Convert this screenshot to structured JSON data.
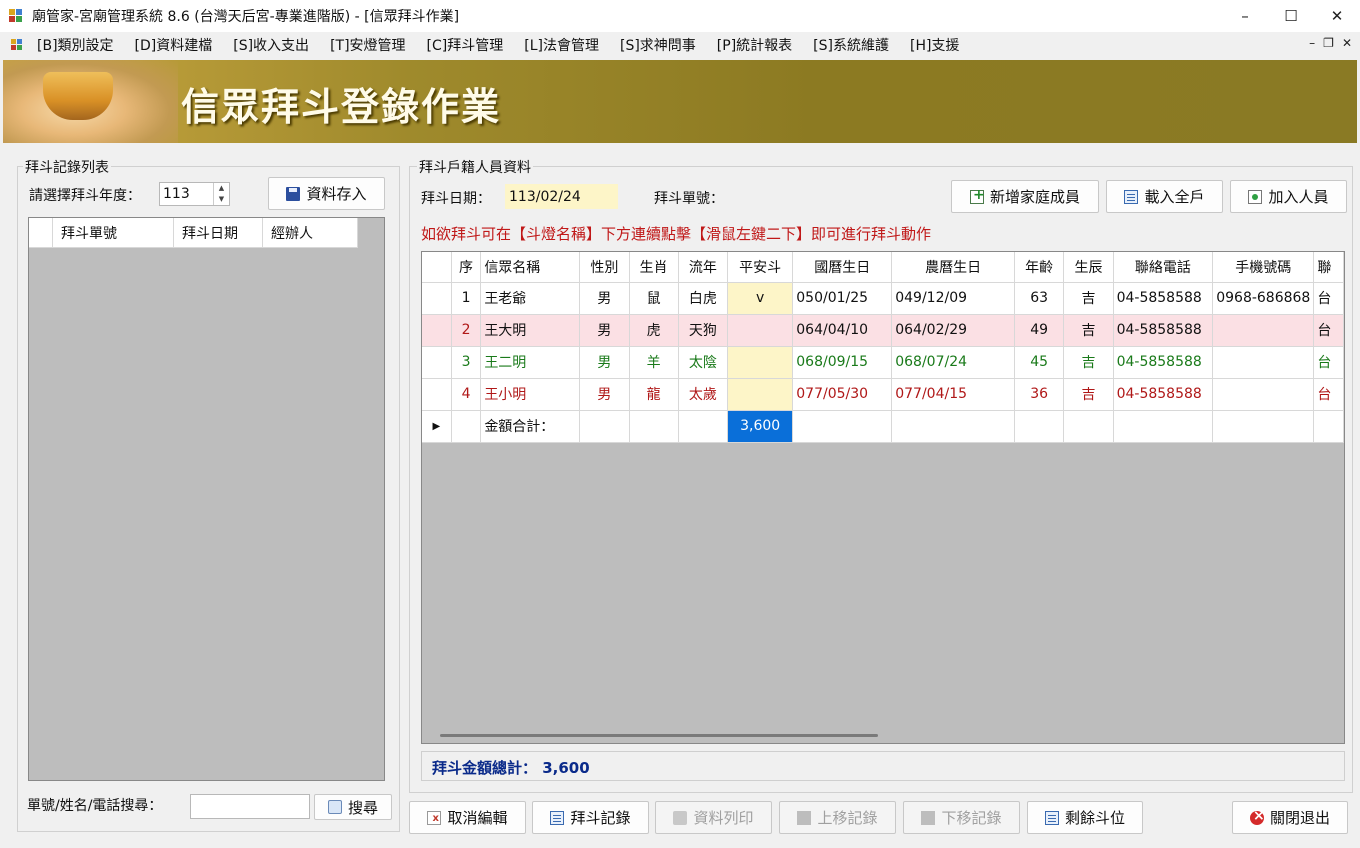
{
  "window": {
    "title": "廟管家-宮廟管理系統 8.6 (台灣天后宮-專業進階版) - [信眾拜斗作業]",
    "controls": [
      "–",
      "☐",
      "✕"
    ]
  },
  "menu": {
    "items": [
      "[B]類別設定",
      "[D]資料建檔",
      "[S]收入支出",
      "[T]安燈管理",
      "[C]拜斗管理",
      "[L]法會管理",
      "[S]求神問事",
      "[P]統計報表",
      "[S]系統維護",
      "[H]支援"
    ],
    "mdi_controls": [
      "–",
      "❐",
      "✕"
    ]
  },
  "banner": {
    "title": "信眾拜斗登錄作業"
  },
  "left_panel": {
    "group_label": "拜斗記錄列表",
    "year_label": "請選擇拜斗年度：",
    "year_value": "113",
    "save_button": "資料存入",
    "list_columns": [
      "拜斗單號",
      "拜斗日期",
      "經辦人"
    ],
    "search_label": "單號/姓名/電話搜尋：",
    "search_value": "",
    "search_button": "搜尋"
  },
  "right_panel": {
    "group_label": "拜斗戶籍人員資料",
    "date_label": "拜斗日期：",
    "date_value": "113/02/24",
    "order_label": "拜斗單號：",
    "buttons": {
      "add_family": "新增家庭成員",
      "load_household": "載入全戶",
      "add_person": "加入人員"
    },
    "notice": "如欲拜斗可在【斗燈名稱】下方連續點擊【滑鼠左鍵二下】即可進行拜斗動作",
    "columns": [
      "序",
      "信眾名稱",
      "性別",
      "生肖",
      "流年",
      "平安斗",
      "國曆生日",
      "農曆生日",
      "年齡",
      "生辰",
      "聯絡電話",
      "手機號碼",
      "聯"
    ],
    "rows": [
      {
        "seq": "1",
        "name": "王老爺",
        "gender": "男",
        "zodiac": "鼠",
        "year_star": "白虎",
        "dou": "v",
        "solar": "050/01/25",
        "lunar": "049/12/09",
        "age": "63",
        "hour": "吉",
        "phone": "04-5858588",
        "mobile": "0968-686868",
        "extra": "台"
      },
      {
        "seq": "2",
        "name": "王大明",
        "gender": "男",
        "zodiac": "虎",
        "year_star": "天狗",
        "dou": "",
        "solar": "064/04/10",
        "lunar": "064/02/29",
        "age": "49",
        "hour": "吉",
        "phone": "04-5858588",
        "mobile": "",
        "extra": "台"
      },
      {
        "seq": "3",
        "name": "王二明",
        "gender": "男",
        "zodiac": "羊",
        "year_star": "太陰",
        "dou": "",
        "solar": "068/09/15",
        "lunar": "068/07/24",
        "age": "45",
        "hour": "吉",
        "phone": "04-5858588",
        "mobile": "",
        "extra": "台"
      },
      {
        "seq": "4",
        "name": "王小明",
        "gender": "男",
        "zodiac": "龍",
        "year_star": "太歲",
        "dou": "",
        "solar": "077/05/30",
        "lunar": "077/04/15",
        "age": "36",
        "hour": "吉",
        "phone": "04-5858588",
        "mobile": "",
        "extra": "台"
      }
    ],
    "sum_row": {
      "label": "金額合計：",
      "value": "3,600"
    },
    "grand_total": "拜斗金額總計： 3,600"
  },
  "bottom_buttons": {
    "cancel_edit": "取消編輯",
    "records": "拜斗記錄",
    "print": "資料列印",
    "move_up": "上移記錄",
    "move_down": "下移記錄",
    "remaining": "剩餘斗位",
    "close": "關閉退出"
  }
}
